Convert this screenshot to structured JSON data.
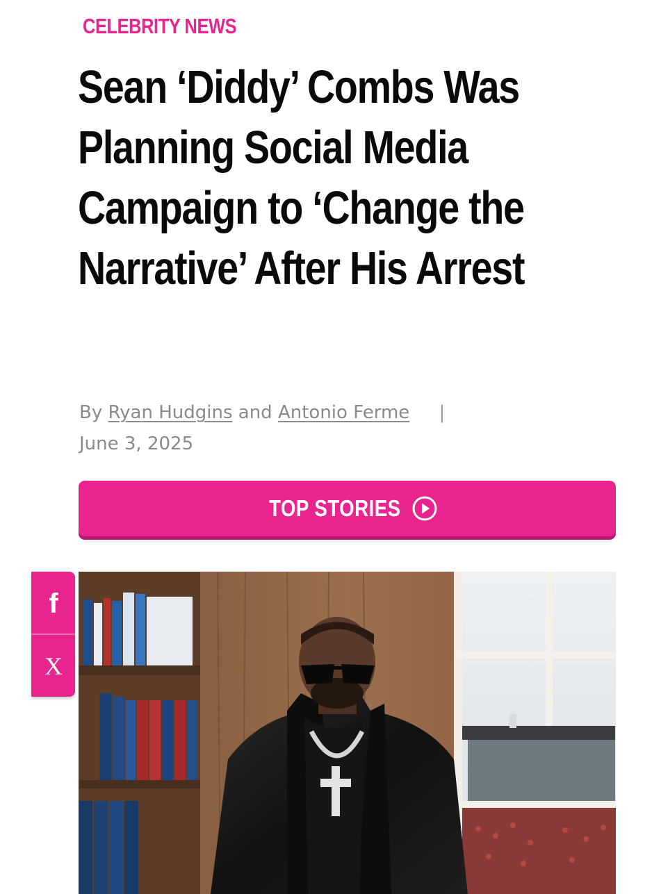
{
  "article": {
    "category": "CELEBRITY NEWS",
    "headline": "Sean ‘Diddy’ Combs Was Planning Social Media Campaign to ‘Change the Narrative’ After His Arrest",
    "byline_prefix": "By",
    "authors": [
      "Ryan Hudgins",
      "Antonio Ferme"
    ],
    "byline_joiner": "and",
    "separator": "|",
    "date": "June 3, 2025"
  },
  "cta": {
    "top_stories_label": "TOP STORIES",
    "icon": "play-circle-icon"
  },
  "share": {
    "facebook_icon": "facebook-icon",
    "facebook_glyph": "f",
    "x_icon": "x-icon",
    "x_glyph": "X"
  },
  "colors": {
    "accent": "#e8258f",
    "headline": "#0a0a0a",
    "meta": "#8a8a8a"
  }
}
